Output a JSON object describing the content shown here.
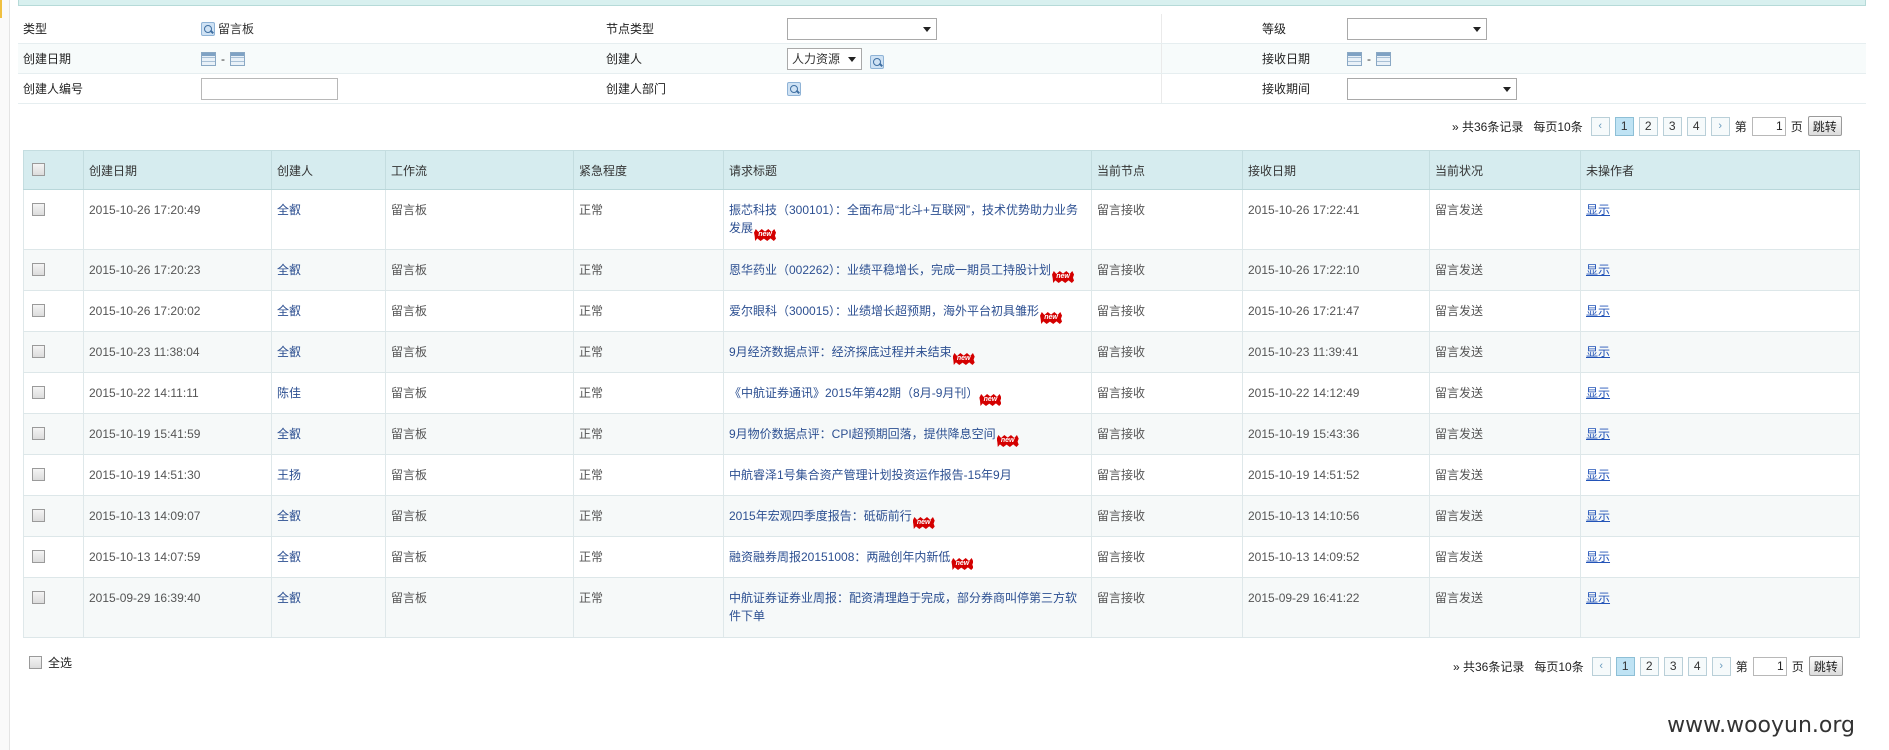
{
  "filters": {
    "row1": {
      "type_label": "类型",
      "type_value": "留言板",
      "node_type_label": "节点类型",
      "node_type_value": "",
      "level_label": "等级",
      "level_value": ""
    },
    "row2": {
      "created_date_label": "创建日期",
      "date_separator": "-",
      "creator_label": "创建人",
      "creator_value": "人力资源",
      "received_date_label": "接收日期"
    },
    "row3": {
      "creator_no_label": "创建人编号",
      "creator_no_value": "",
      "creator_dept_label": "创建人部门",
      "receive_period_label": "接收期间",
      "receive_period_value": ""
    }
  },
  "pager": {
    "summary": "» 共36条记录",
    "per_page": "每页10条",
    "prev": "‹",
    "next": "›",
    "pages": [
      "1",
      "2",
      "3",
      "4"
    ],
    "current_page": "1",
    "page_prefix": "第",
    "page_suffix": "页",
    "page_input": "1",
    "jump_label": "跳转"
  },
  "table": {
    "columns": [
      "创建日期",
      "创建人",
      "工作流",
      "紧急程度",
      "请求标题",
      "当前节点",
      "接收日期",
      "当前状况",
      "未操作者"
    ],
    "new_badge": "new",
    "rows": [
      {
        "created": "2015-10-26 17:20:49",
        "creator": "全叡",
        "workflow": "留言板",
        "urgency": "正常",
        "title": "振芯科技（300101）：全面布局“北斗+互联网”，技术优势助力业务发展",
        "node": "留言接收",
        "received": "2015-10-26 17:22:41",
        "status": "留言发送",
        "action": "显示"
      },
      {
        "created": "2015-10-26 17:20:23",
        "creator": "全叡",
        "workflow": "留言板",
        "urgency": "正常",
        "title": "恩华药业（002262）：业绩平稳增长，完成一期员工持股计划",
        "node": "留言接收",
        "received": "2015-10-26 17:22:10",
        "status": "留言发送",
        "action": "显示"
      },
      {
        "created": "2015-10-26 17:20:02",
        "creator": "全叡",
        "workflow": "留言板",
        "urgency": "正常",
        "title": "爱尔眼科（300015）：业绩增长超预期，海外平台初具雏形",
        "node": "留言接收",
        "received": "2015-10-26 17:21:47",
        "status": "留言发送",
        "action": "显示"
      },
      {
        "created": "2015-10-23 11:38:04",
        "creator": "全叡",
        "workflow": "留言板",
        "urgency": "正常",
        "title": "9月经济数据点评：经济探底过程并未结束",
        "node": "留言接收",
        "received": "2015-10-23 11:39:41",
        "status": "留言发送",
        "action": "显示"
      },
      {
        "created": "2015-10-22 14:11:11",
        "creator": "陈佳",
        "workflow": "留言板",
        "urgency": "正常",
        "title": "《中航证券通讯》2015年第42期（8月-9月刊）",
        "node": "留言接收",
        "received": "2015-10-22 14:12:49",
        "status": "留言发送",
        "action": "显示"
      },
      {
        "created": "2015-10-19 15:41:59",
        "creator": "全叡",
        "workflow": "留言板",
        "urgency": "正常",
        "title": "9月物价数据点评：CPI超预期回落，提供降息空间",
        "node": "留言接收",
        "received": "2015-10-19 15:43:36",
        "status": "留言发送",
        "action": "显示"
      },
      {
        "created": "2015-10-19 14:51:30",
        "creator": "王扬",
        "workflow": "留言板",
        "urgency": "正常",
        "title": "中航睿泽1号集合资产管理计划投资运作报告-15年9月",
        "node": "留言接收",
        "received": "2015-10-19 14:51:52",
        "status": "留言发送",
        "action": "显示"
      },
      {
        "created": "2015-10-13 14:09:07",
        "creator": "全叡",
        "workflow": "留言板",
        "urgency": "正常",
        "title": "2015年宏观四季度报告：砥砺前行",
        "node": "留言接收",
        "received": "2015-10-13 14:10:56",
        "status": "留言发送",
        "action": "显示"
      },
      {
        "created": "2015-10-13 14:07:59",
        "creator": "全叡",
        "workflow": "留言板",
        "urgency": "正常",
        "title": "融资融券周报20151008：两融创年内新低",
        "node": "留言接收",
        "received": "2015-10-13 14:09:52",
        "status": "留言发送",
        "action": "显示"
      },
      {
        "created": "2015-09-29 16:39:40",
        "creator": "全叡",
        "workflow": "留言板",
        "urgency": "正常",
        "title": "中航证券证券业周报：配资清理趋于完成，部分券商叫停第三方软件下单",
        "node": "留言接收",
        "received": "2015-09-29 16:41:22",
        "status": "留言发送",
        "action": "显示"
      }
    ]
  },
  "footer": {
    "select_all": "全选"
  },
  "watermark": "www.wooyun.org"
}
